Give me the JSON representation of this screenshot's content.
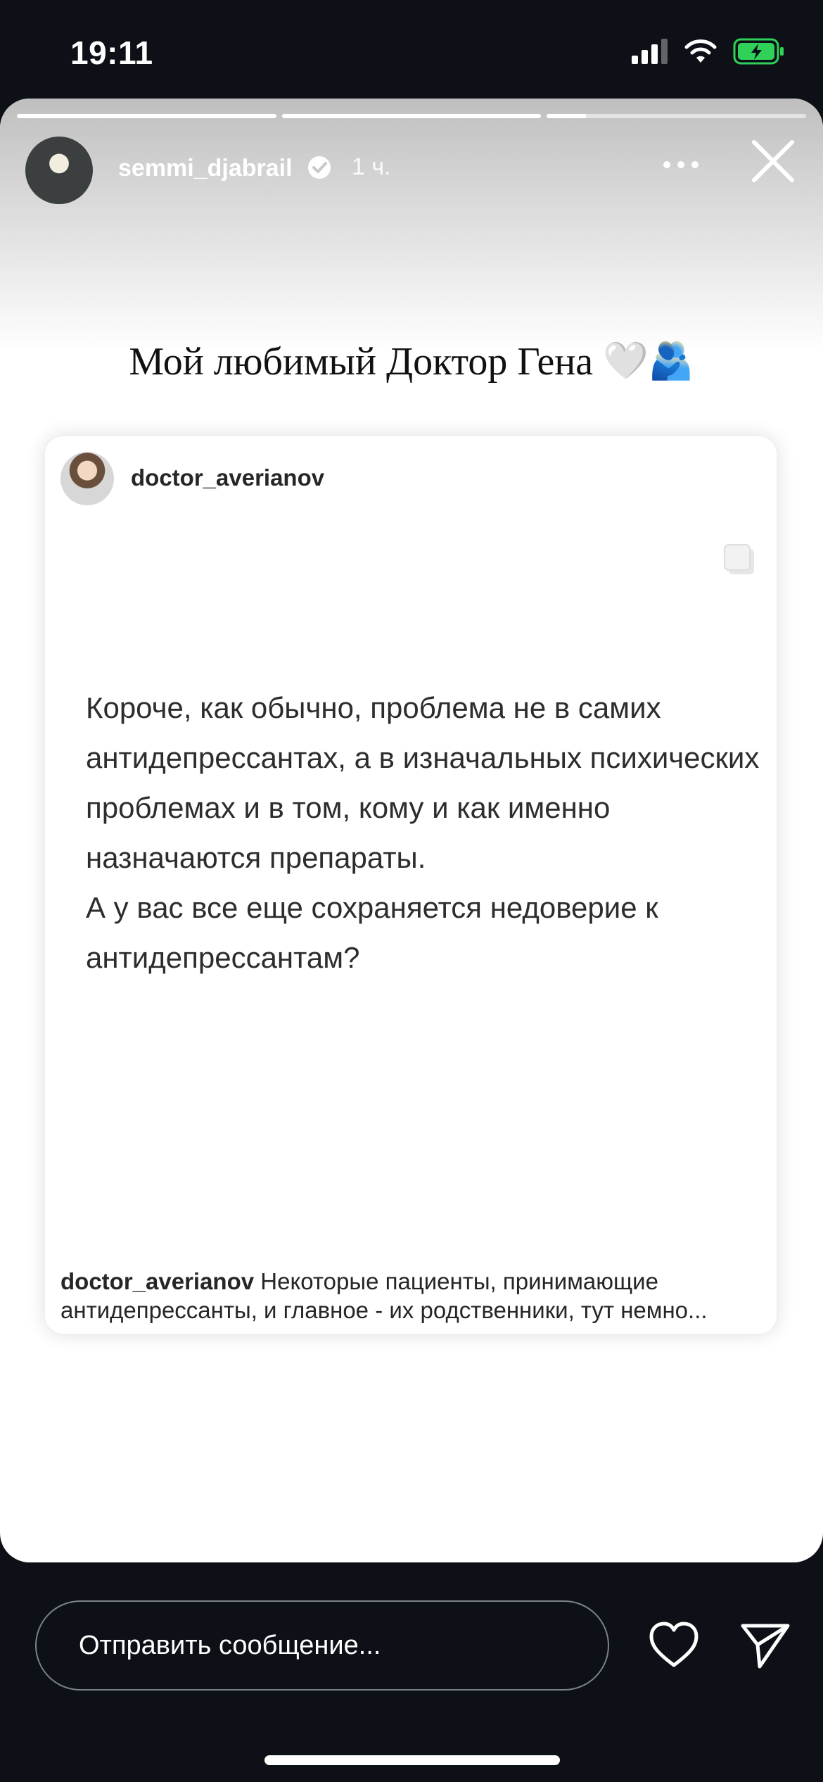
{
  "status_bar": {
    "time": "19:11",
    "icons": [
      "cellular-signal-icon",
      "wifi-icon",
      "battery-charging-icon"
    ],
    "battery_color": "#30d158"
  },
  "story": {
    "progress": [
      1.0,
      1.0,
      0.15
    ],
    "author": {
      "username": "semmi_djabrail",
      "verified": true,
      "time_ago": "1 ч."
    },
    "caption": {
      "text": "Мой любимый Доктор Гена",
      "emojis": "🤍🫂"
    },
    "shared_post": {
      "author": "doctor_averianov",
      "text_paragraphs": [
        "Короче, как обычно, проблема не в самих антидепрессантах, а в изначальных психических проблемах и в том, кому и как именно назначаются препараты.",
        "А у вас все еще сохраняется недоверие к антидепрессантам?"
      ],
      "caption_author": "doctor_averianov",
      "caption_text": "Некоторые пациенты, принимающие антидепрессанты, и главное - их родственники, тут немно..."
    }
  },
  "reply": {
    "placeholder": "Отправить сообщение..."
  }
}
